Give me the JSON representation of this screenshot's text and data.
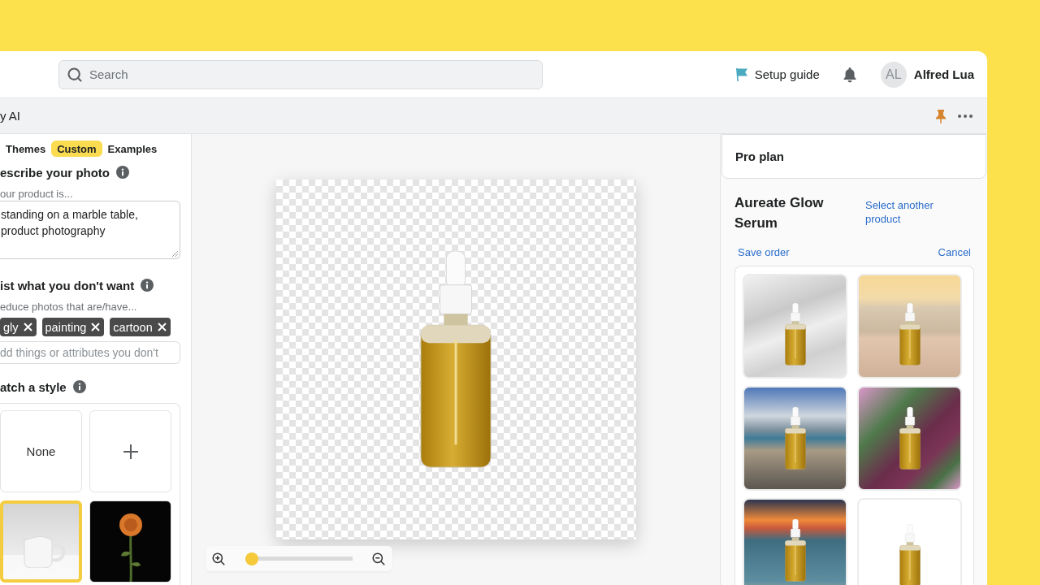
{
  "top_bar": {
    "search": {
      "placeholder": "Search"
    },
    "setup_guide": "Setup guide",
    "user": {
      "initials": "AL",
      "name": "Alfred Lua"
    }
  },
  "sub_bar": {
    "title": "y AI"
  },
  "left_panel": {
    "tabs": [
      {
        "label": "Themes",
        "selected": false
      },
      {
        "label": "Custom",
        "selected": true
      },
      {
        "label": "Examples",
        "selected": false
      }
    ],
    "describe": {
      "heading": "escribe your photo",
      "label": "our product is...",
      "value": "standing on a marble table, product photography"
    },
    "exclude": {
      "heading": "ist what you don't want",
      "label": "educe photos that are/have...",
      "tags": [
        "gly",
        "painting",
        "cartoon"
      ],
      "input": {
        "placeholder": "dd things or attributes you don't"
      }
    },
    "style": {
      "heading": "atch a style",
      "options": [
        {
          "kind": "none",
          "label": "None",
          "selected": false
        },
        {
          "kind": "add",
          "selected": false
        },
        {
          "kind": "photo",
          "selected": true
        },
        {
          "kind": "photo",
          "selected": false
        }
      ]
    }
  },
  "canvas": {
    "zoom": {
      "level": 0
    }
  },
  "right_panel": {
    "plan": "Pro plan",
    "product": {
      "title": "Aureate Glow Serum",
      "change_link": "Select another product"
    },
    "save_order": "Save order",
    "cancel": "Cancel"
  }
}
